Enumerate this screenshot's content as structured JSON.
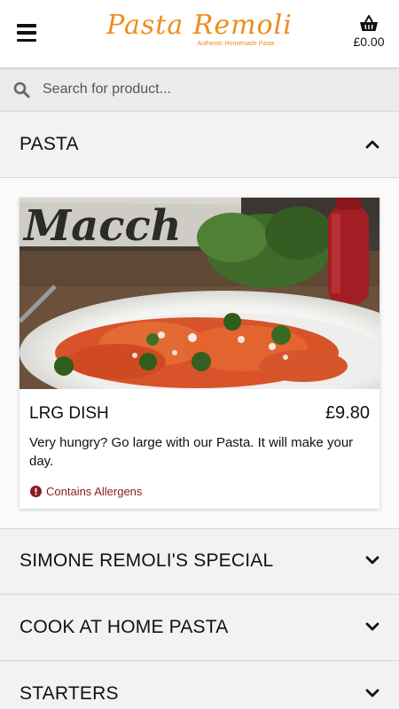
{
  "header": {
    "logo_text": "Pasta Remoli",
    "logo_tagline": "Authentic Homemade Pasta",
    "basket_total": "£0.00",
    "menu_icon": "hamburger-menu-icon",
    "basket_icon": "basket-icon"
  },
  "search": {
    "placeholder": "Search for product...",
    "value": "",
    "icon": "search-icon"
  },
  "categories": [
    {
      "label": "PASTA",
      "expanded": true
    },
    {
      "label": "SIMONE REMOLI'S SPECIAL",
      "expanded": false
    },
    {
      "label": "COOK AT HOME PASTA",
      "expanded": false
    },
    {
      "label": "STARTERS",
      "expanded": false
    }
  ],
  "products": [
    {
      "name": "LRG DISH",
      "price": "£9.80",
      "description": "Very hungry? Go large with our Pasta. It will make your day.",
      "allergen_label": "Contains Allergens"
    }
  ],
  "colors": {
    "brand": "#f08c1a",
    "allergen": "#8a1c1c"
  }
}
